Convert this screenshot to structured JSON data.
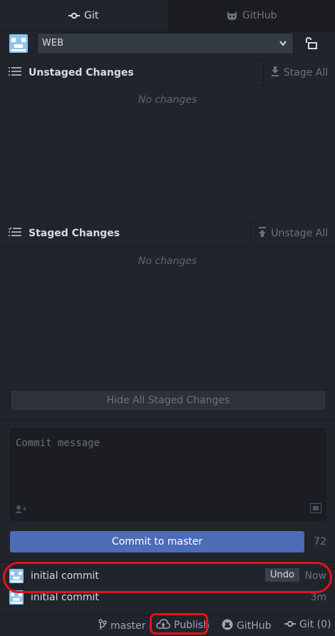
{
  "tabs": {
    "git_label": "Git",
    "github_label": "GitHub"
  },
  "repo": {
    "selected": "WEB"
  },
  "unstaged": {
    "title": "Unstaged Changes",
    "action": "Stage All",
    "empty": "No changes"
  },
  "staged": {
    "title": "Staged Changes",
    "action": "Unstage All",
    "empty": "No changes",
    "hide_button": "Hide All Staged Changes"
  },
  "commit": {
    "placeholder": "Commit message",
    "button": "Commit to master",
    "remaining": "72"
  },
  "recent_commits": [
    {
      "message": "initial commit",
      "undo": "Undo",
      "time": "Now"
    },
    {
      "message": "initial commit",
      "time": "3m"
    }
  ],
  "status_bar": {
    "branch": "master",
    "publish": "Publish",
    "github": "GitHub",
    "git": "Git (0)"
  },
  "colors": {
    "background": "#21252b",
    "accent": "#4c6cb8",
    "highlight": "#e8101a"
  }
}
